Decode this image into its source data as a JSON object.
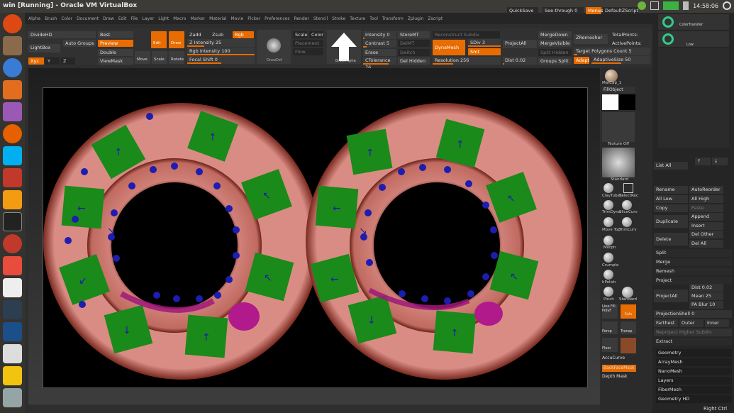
{
  "window": {
    "title": "win [Running] - Oracle VM VirtualBox"
  },
  "tray": {
    "time": "14:58:06"
  },
  "menu": {
    "items": [
      "Alpha",
      "Brush",
      "Color",
      "Document",
      "Draw",
      "Edit",
      "File",
      "Layer",
      "Light",
      "Macro",
      "Marker",
      "Material",
      "Movie",
      "Picker",
      "Preferences",
      "Render",
      "Stencil",
      "Stroke",
      "Texture",
      "Tool",
      "Transform",
      "Zplugin",
      "Zscript"
    ]
  },
  "topright": {
    "quicksave": "QuickSave",
    "seethrough": "See-through 0",
    "menus": "Menus",
    "defaultzscript": "DefaultZScript"
  },
  "toolbar": {
    "dividehd": "DivideHD",
    "best": "Best",
    "lightbox": "LightBox",
    "autogroups": "Auto Groups",
    "preview": "Preview",
    "double": "Double",
    "viewmask": "ViewMask",
    "xyz": "Xyz",
    "y": "Y",
    "z": "Z",
    "move": "Move",
    "scale": "Scale",
    "rotate": "Rotate",
    "edit": "Edit",
    "draw": "Draw",
    "zadd": "Zadd",
    "zsub": "Zsub",
    "rgb": "Rgb",
    "zintensity": "Z Intensity 25",
    "rgbintensity": "Rgb Intensity 100",
    "focalshift": "Focal Shift 0",
    "drawsize": "DrawDef",
    "scale_lbl": "Scale",
    "color_lbl": "Color",
    "placement": "Placement",
    "flow": "Flow",
    "intensity": "Intensity 0",
    "contrast": "Contrast 5",
    "erase": "Erase",
    "ctolerance": "CTolerance 76",
    "storemt": "StoreMT",
    "delmt": "DelMT",
    "switch": "Switch",
    "delhidden": "Del Hidden",
    "reconstruct": "Reconstruct Subdiv",
    "dynamesh": "DynaMesh",
    "sdiv": "SDiv 3",
    "smt": "Smt",
    "resolution": "Resolution 256",
    "projectall": "ProjectAll",
    "dist": "Dist 0.02",
    "mergedown": "MergeDown",
    "mergevisible": "MergeVisible",
    "splithidden": "Split Hidden",
    "groupssplit": "Groups Split",
    "zremesher": "ZRemesher",
    "totalpoints": "TotalPoints:",
    "activepoints": "ActivePoints:",
    "target": "Target Polygons Count 5",
    "adapt": "Adapt",
    "adaptivesize": "AdaptiveSize 50",
    "brushalpha": "BrushAlpha"
  },
  "shelf": {
    "matcap": "MatCap_1",
    "fillobject": "FillObject",
    "texture": "Texture Off",
    "standard": "Standard",
    "brushes": [
      "ClayTubes",
      "SelectRec",
      "TrimDyna",
      "SliceCurv",
      "Move Top",
      "TrimCurv",
      "Morph",
      "Crumple",
      "hPolish",
      "Pinch",
      "Standard",
      "Line Fill",
      "Solo",
      "Persp",
      "Transp",
      "Floor"
    ],
    "polyf": "PolyF",
    "accucurve": "AccuCurve",
    "backfacemask": "BackFaceMask",
    "depthmask": "Depth Mask"
  },
  "rightpanel": {
    "colortransfer": "ColorTransfer",
    "low": "Low",
    "listall": "List All",
    "rename": "Rename",
    "autoreorder": "AutoReorder",
    "alllow": "All Low",
    "allhigh": "All High",
    "copy": "Copy",
    "paste": "Paste",
    "duplicate": "Duplicate",
    "append": "Append",
    "insert": "Insert",
    "delete": "Delete",
    "delother": "Del Other",
    "delall": "Del All",
    "split": "Split",
    "merge": "Merge",
    "remesh": "Remesh",
    "project": "Project",
    "projectall": "ProjectAll",
    "dist": "Dist 0.02",
    "mean": "Mean 25",
    "pablur": "PA Blur 10",
    "projectionshell": "ProjectionShell 0",
    "farthest": "Farthest",
    "outer": "Outer",
    "inner": "Inner",
    "reproject": "Reproject Higher Subdiv",
    "extract": "Extract",
    "sections": [
      "Geometry",
      "ArrayMesh",
      "NanoMesh",
      "Layers",
      "FiberMesh",
      "Geometry HD"
    ]
  },
  "status": {
    "rightctrl": "Right Ctrl"
  }
}
